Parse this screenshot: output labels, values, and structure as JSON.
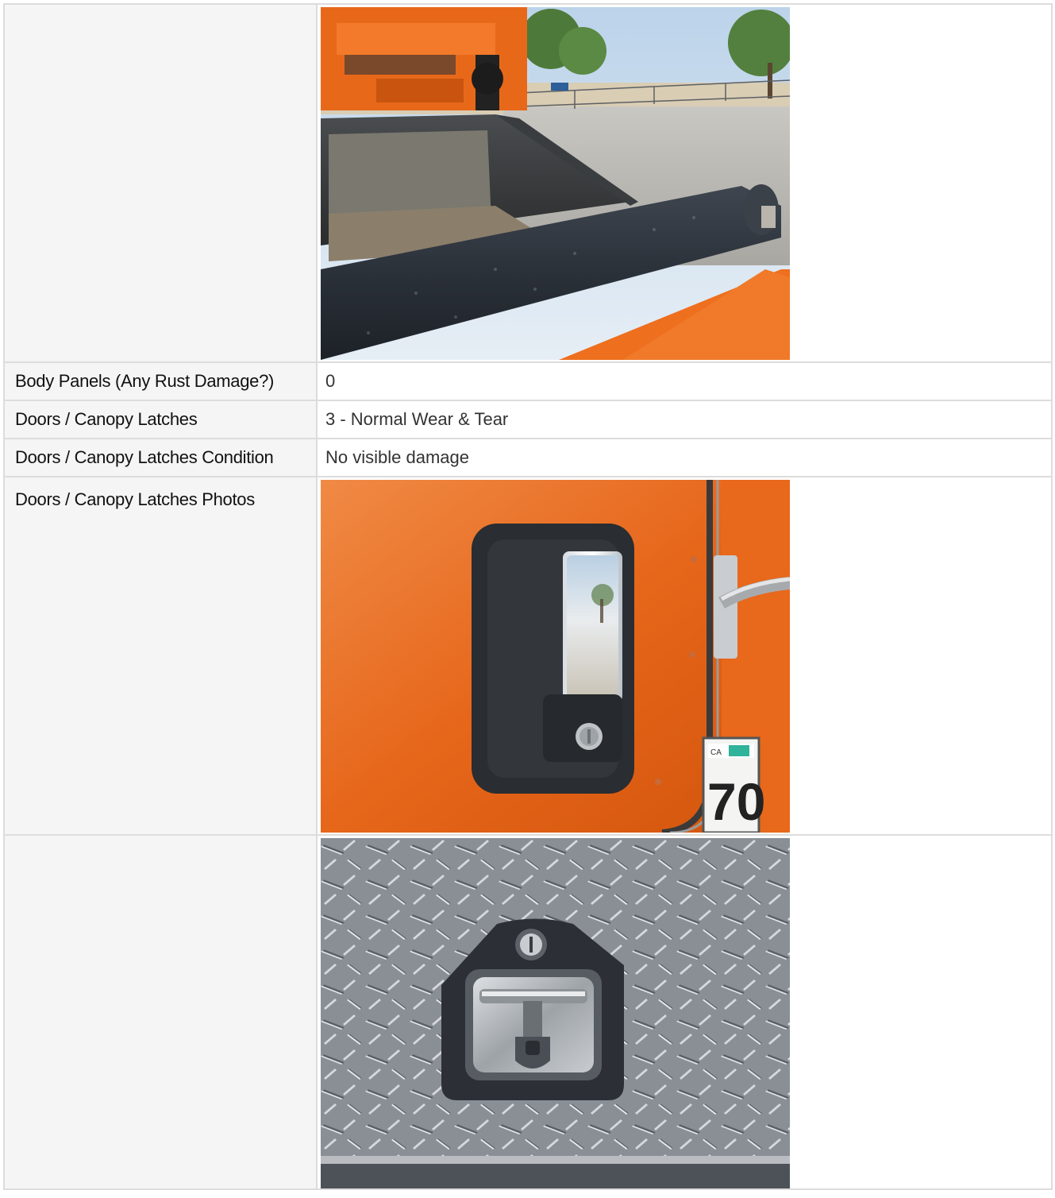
{
  "rows": [
    {
      "label": "",
      "photo": "dump-bed-photo"
    },
    {
      "label": "Body Panels (Any Rust Damage?)",
      "value": "0"
    },
    {
      "label": "Doors / Canopy Latches",
      "value": "3 - Normal Wear & Tear"
    },
    {
      "label": "Doors / Canopy Latches Condition",
      "value": "No visible damage"
    },
    {
      "label": "Doors / Canopy Latches Photos",
      "photo": "door-handle-photo",
      "sticker_text": "70"
    },
    {
      "label": "",
      "photo": "toolbox-latch-photo"
    }
  ]
}
